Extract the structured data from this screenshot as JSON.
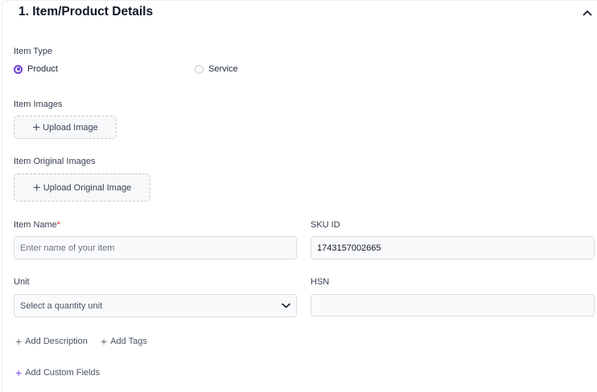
{
  "section": {
    "title": "1. Item/Product Details"
  },
  "item_type": {
    "label": "Item Type",
    "options": [
      {
        "label": "Product",
        "selected": true
      },
      {
        "label": "Service",
        "selected": false
      }
    ]
  },
  "item_images": {
    "label": "Item Images",
    "button": "Upload Image"
  },
  "item_original_images": {
    "label": "Item Original Images",
    "button": "Upload Original Image"
  },
  "item_name": {
    "label": "Item Name",
    "required_mark": "*",
    "placeholder": "Enter name of your item",
    "value": ""
  },
  "sku": {
    "label": "SKU ID",
    "value": "1743157002665"
  },
  "unit": {
    "label": "Unit",
    "placeholder": "Select a quantity unit"
  },
  "hsn": {
    "label": "HSN",
    "value": ""
  },
  "actions": {
    "add_description": "Add Description",
    "add_tags": "Add Tags",
    "add_custom_fields": "Add Custom Fields"
  },
  "colors": {
    "accent": "#6d3fd6",
    "required": "#dc2626"
  },
  "icons": {
    "collapse": "chevron-up-icon",
    "unit_dropdown": "chevron-down-icon",
    "add": "plus-icon"
  }
}
